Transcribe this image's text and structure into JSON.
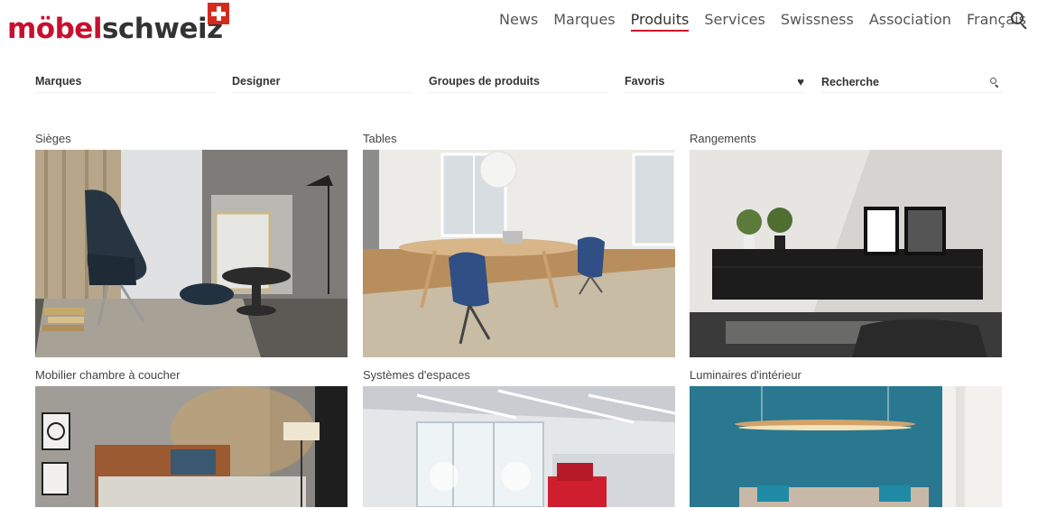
{
  "logo": {
    "part1": "möbel",
    "part2": "schweiz"
  },
  "nav": [
    {
      "label": "News"
    },
    {
      "label": "Marques"
    },
    {
      "label": "Produits",
      "active": true
    },
    {
      "label": "Services"
    },
    {
      "label": "Swissness"
    },
    {
      "label": "Association"
    },
    {
      "label": "Français"
    }
  ],
  "filters": {
    "brands": "Marques",
    "designer": "Designer",
    "product_groups": "Groupes de produits",
    "favorites": "Favoris",
    "search_placeholder": "Recherche"
  },
  "categories": [
    {
      "title": "Sièges"
    },
    {
      "title": "Tables"
    },
    {
      "title": "Rangements"
    },
    {
      "title": "Mobilier chambre à coucher"
    },
    {
      "title": "Systèmes d'espaces"
    },
    {
      "title": "Luminaires d'intérieur"
    }
  ],
  "colors": {
    "brand_red": "#c8102e",
    "swiss_flag": "#d52b1e",
    "wall_teal": "#2a7890"
  }
}
